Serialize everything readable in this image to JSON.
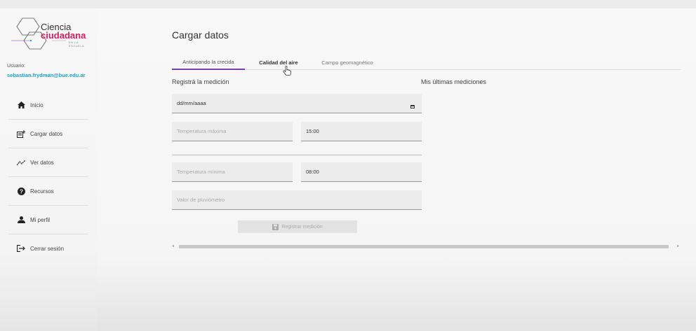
{
  "logo": {
    "line1": "Ciencia",
    "line2": "ciudadana",
    "line3": "EN LA ESCUELA"
  },
  "user": {
    "label": "Usuario:",
    "email": "sebastian.frydman@bue.edu.ar"
  },
  "nav": [
    {
      "label": "Inicio",
      "icon": "home-icon"
    },
    {
      "label": "Cargar datos",
      "icon": "upload-data-icon"
    },
    {
      "label": "Ver datos",
      "icon": "chart-line-icon"
    },
    {
      "label": "Recursos",
      "icon": "help-icon"
    },
    {
      "label": "Mi perfil",
      "icon": "person-icon"
    },
    {
      "label": "Cerrar sesión",
      "icon": "logout-icon"
    }
  ],
  "page": {
    "title": "Cargar datos"
  },
  "tabs": [
    {
      "label": "Anticipando la crecida"
    },
    {
      "label": "Calidad del aire"
    },
    {
      "label": "Campo geomagnético"
    }
  ],
  "form": {
    "section_label": "Registrá la medición",
    "date_value": "dd/mm/aaaa",
    "temp_max_placeholder": "Temperatura máxima",
    "time_max_value": "15:00",
    "temp_min_placeholder": "Temperatura mínima",
    "time_min_value": "08:00",
    "rain_placeholder": "Valor de pluviómetro",
    "save_label": "Registrar medición"
  },
  "history": {
    "label": "Mis últimas mediciones"
  },
  "colors": {
    "accent": "#7b3fb0",
    "email": "#19a3c9",
    "brand": "#d81b60"
  }
}
